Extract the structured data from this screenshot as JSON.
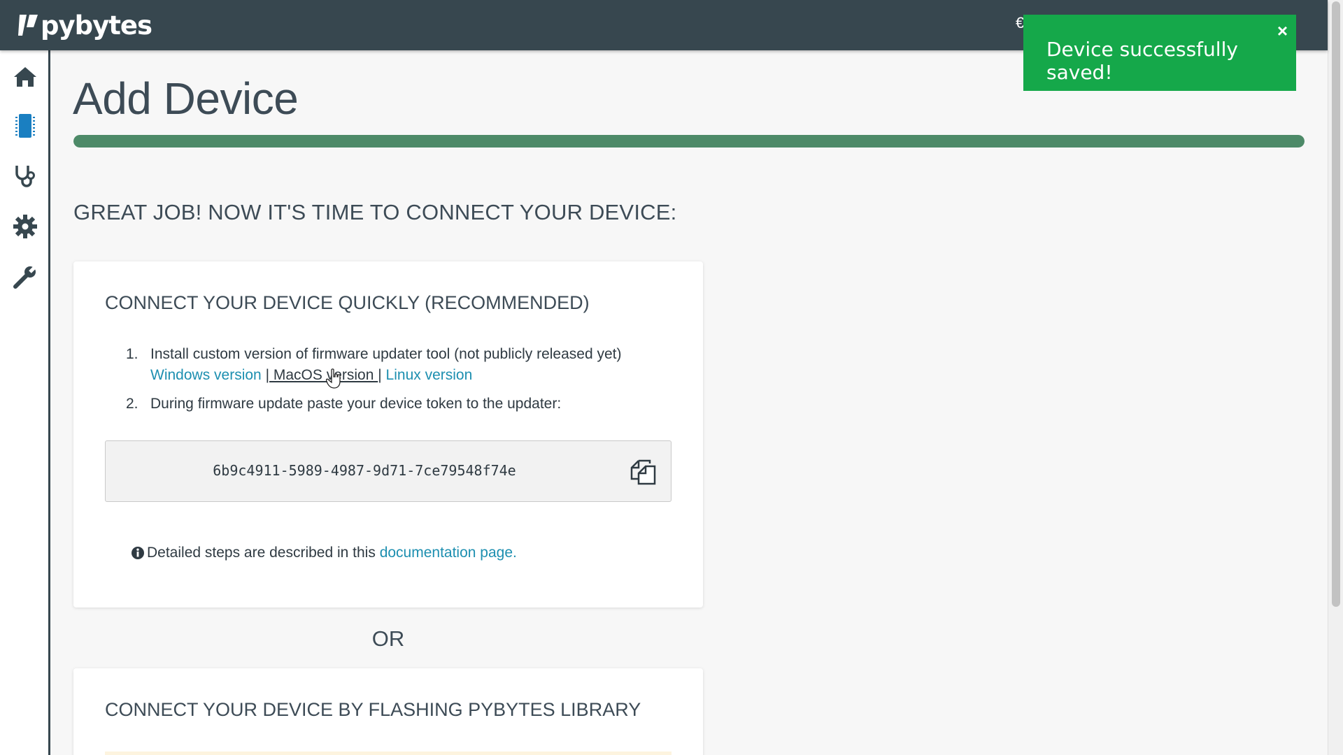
{
  "header": {
    "logo_text": "pybytes",
    "partial_glyph": "€"
  },
  "sidebar": {
    "items": [
      {
        "name": "home",
        "icon": "home-icon",
        "active": false
      },
      {
        "name": "devices",
        "icon": "device-chip-icon",
        "active": true
      },
      {
        "name": "diagnostics",
        "icon": "stethoscope-icon",
        "active": false
      },
      {
        "name": "settings",
        "icon": "gear-icon",
        "active": false
      },
      {
        "name": "tools",
        "icon": "wrench-icon",
        "active": false
      }
    ]
  },
  "page": {
    "title": "Add Device",
    "progress_percent": 100,
    "section_heading": "GREAT JOB! NOW IT'S TIME TO CONNECT YOUR DEVICE:"
  },
  "quick_connect": {
    "title": "CONNECT YOUR DEVICE QUICKLY (RECOMMENDED)",
    "step1_num": "1.",
    "step1_text": "Install custom version of firmware updater tool (not publicly released yet)",
    "link_windows": "Windows version",
    "sep1": " |",
    "link_macos": " MacOS version ",
    "sep2": "| ",
    "link_linux": "Linux version",
    "step2_num": "2.",
    "step2_text": "During firmware update paste your device token to the updater:",
    "token": "6b9c4911-5989-4987-9d71-7ce79548f74e",
    "info_text": "Detailed steps are described in this ",
    "info_link": "documentation page."
  },
  "or_label": "OR",
  "flash_connect": {
    "title": "CONNECT YOUR DEVICE BY FLASHING PYBYTES LIBRARY"
  },
  "toast": {
    "message": "Device successfully saved!",
    "close_label": "×"
  },
  "colors": {
    "topbar": "#37474f",
    "accent_link": "#1d8fb0",
    "progress": "#4d8a68",
    "toast": "#15a84a",
    "active_icon": "#1a7fc1"
  }
}
